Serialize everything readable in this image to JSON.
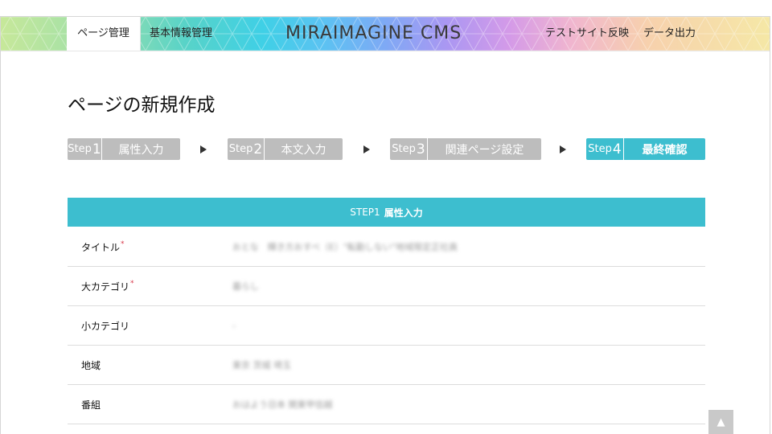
{
  "header": {
    "logo": "MIRAIMAGINE CMS",
    "nav": {
      "page_management": "ページ管理",
      "basic_info": "基本情報管理",
      "test_site": "テストサイト反映",
      "data_export": "データ出力"
    }
  },
  "main": {
    "title": "ページの新規作成",
    "steps": [
      {
        "prefix": "Step",
        "num": "1",
        "label": "属性入力",
        "state": "done"
      },
      {
        "prefix": "Step",
        "num": "2",
        "label": "本文入力",
        "state": "done"
      },
      {
        "prefix": "Step",
        "num": "3",
        "label": "関連ページ設定",
        "state": "done"
      },
      {
        "prefix": "Step",
        "num": "4",
        "label": "最終確認",
        "state": "current"
      }
    ],
    "section": {
      "prefix": "STEP1",
      "label": "属性入力"
    },
    "fields": [
      {
        "label": "タイトル",
        "required": "*",
        "value": "おとな　輝き方おすべ（E）\"転勤しない\"地域限定正社員"
      },
      {
        "label": "大カテゴリ",
        "required": "*",
        "value": "暮らし"
      },
      {
        "label": "小カテゴリ",
        "required": "",
        "value": "-"
      },
      {
        "label": "地域",
        "required": "",
        "value": "東京 茨城 埼玉"
      },
      {
        "label": "番組",
        "required": "",
        "value": "おはよう日本 関東甲信越"
      }
    ]
  },
  "back_to_top": "▲",
  "colors": {
    "accent": "#3dbecf",
    "step_inactive": "#bdbdbd",
    "required": "#d8384a"
  }
}
